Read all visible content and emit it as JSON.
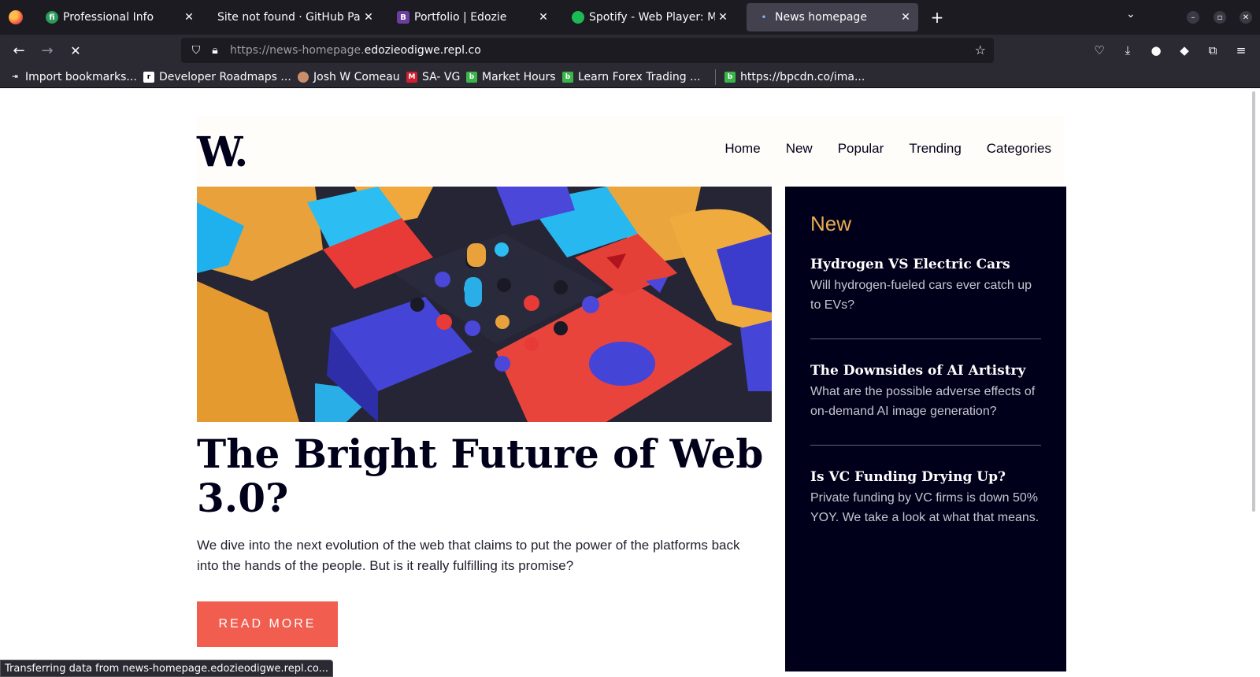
{
  "browser": {
    "tabs": [
      {
        "title": "Professional Info",
        "favicon": "fi",
        "favicon_color": "#2a9d5b"
      },
      {
        "title": "Site not found · GitHub Pages",
        "favicon": "",
        "favicon_color": "#1c1b22"
      },
      {
        "title": "Portfolio | Edozie",
        "favicon": "B",
        "favicon_color": "#6b3fa0"
      },
      {
        "title": "Spotify - Web Player: Music",
        "favicon": "",
        "favicon_color": "#1db954"
      },
      {
        "title": "News homepage",
        "favicon": "",
        "favicon_color": "#1c1b22"
      }
    ],
    "url": {
      "prefix": "https://news-homepage.",
      "domain": "edozieodigwe.repl.co"
    },
    "bookmarks": [
      {
        "label": "Import bookmarks...",
        "icon": "import-icon"
      },
      {
        "label": "Developer Roadmaps ...",
        "icon": "roadmap-icon"
      },
      {
        "label": "Josh W Comeau",
        "icon": "josh-icon"
      },
      {
        "label": "SA- VG",
        "icon": "m-icon"
      },
      {
        "label": "Market Hours",
        "icon": "b-icon"
      },
      {
        "label": "Learn Forex Trading ...",
        "icon": "b-icon"
      },
      {
        "label": "https://bpcdn.co/ima...",
        "icon": "b-icon"
      }
    ],
    "status": "Transferring data from news-homepage.edozieodigwe.repl.co..."
  },
  "site": {
    "logo": "W.",
    "nav": [
      "Home",
      "New",
      "Popular",
      "Trending",
      "Categories"
    ],
    "headline": "The Bright Future of Web 3.0?",
    "lede": "We dive into the next evolution of the web that claims to put the power of the platforms back into the hands of the people. But is it really fulfilling its promise?",
    "cta": "READ MORE",
    "sidebar": {
      "title": "New",
      "items": [
        {
          "title": "Hydrogen VS Electric Cars",
          "desc": "Will hydrogen-fueled cars ever catch up to EVs?"
        },
        {
          "title": "The Downsides of AI Artistry",
          "desc": "What are the possible adverse effects of on-demand AI image generation?"
        },
        {
          "title": "Is VC Funding Drying Up?",
          "desc": "Private funding by VC firms is down 50% YOY. We take a look at what that means."
        }
      ]
    },
    "colors": {
      "accent": "#f15e50",
      "sidebar_bg": "#00001a",
      "sidebar_title": "#e9ab53"
    }
  }
}
